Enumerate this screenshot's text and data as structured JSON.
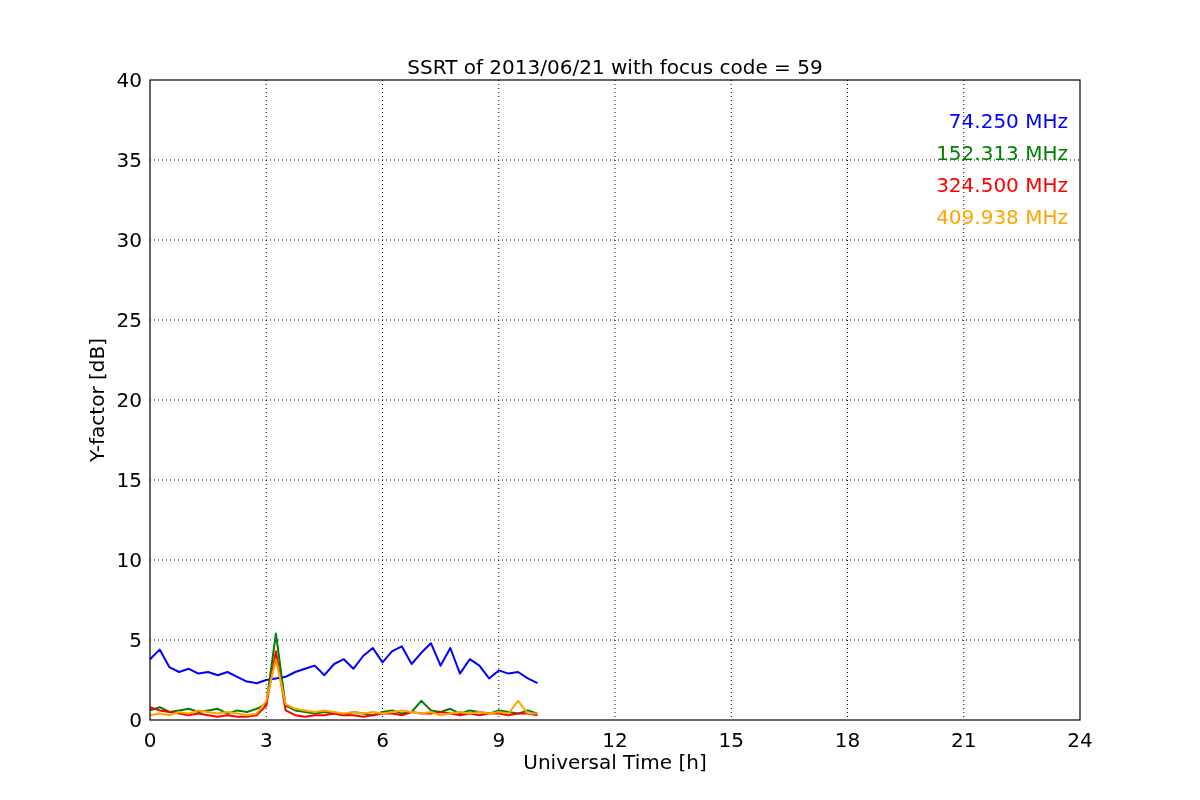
{
  "chart_data": {
    "type": "line",
    "title": "SSRT of 2013/06/21 with focus code = 59",
    "xlabel": "Universal Time [h]",
    "ylabel": "Y-factor [dB]",
    "x": [
      0,
      0.25,
      0.5,
      0.75,
      1,
      1.25,
      1.5,
      1.75,
      2,
      2.25,
      2.5,
      2.75,
      3,
      3.25,
      3.5,
      3.75,
      4,
      4.25,
      4.5,
      4.75,
      5,
      5.25,
      5.5,
      5.75,
      6,
      6.25,
      6.5,
      6.75,
      7,
      7.25,
      7.5,
      7.75,
      8,
      8.25,
      8.5,
      8.75,
      9,
      9.25,
      9.5,
      9.75,
      10
    ],
    "series": [
      {
        "name": "74.250 MHz",
        "color": "#0000ff",
        "values": [
          3.8,
          4.4,
          3.3,
          3.0,
          3.2,
          2.9,
          3.0,
          2.8,
          3.0,
          2.7,
          2.4,
          2.3,
          2.5,
          2.6,
          2.7,
          3.0,
          3.2,
          3.4,
          2.8,
          3.5,
          3.8,
          3.2,
          4.0,
          4.5,
          3.6,
          4.3,
          4.6,
          3.5,
          4.2,
          4.8,
          3.4,
          4.5,
          2.9,
          3.8,
          3.4,
          2.6,
          3.1,
          2.9,
          3.0,
          2.6,
          2.3
        ]
      },
      {
        "name": "152.313 MHz",
        "color": "#008000",
        "values": [
          0.6,
          0.8,
          0.5,
          0.6,
          0.7,
          0.5,
          0.6,
          0.7,
          0.4,
          0.6,
          0.5,
          0.7,
          1.0,
          5.4,
          0.9,
          0.6,
          0.5,
          0.4,
          0.5,
          0.4,
          0.3,
          0.5,
          0.4,
          0.3,
          0.5,
          0.6,
          0.4,
          0.5,
          1.2,
          0.6,
          0.5,
          0.7,
          0.4,
          0.6,
          0.5,
          0.4,
          0.6,
          0.5,
          0.4,
          0.6,
          0.4
        ]
      },
      {
        "name": "324.500 MHz",
        "color": "#ff0000",
        "values": [
          0.8,
          0.6,
          0.5,
          0.4,
          0.3,
          0.4,
          0.3,
          0.2,
          0.3,
          0.2,
          0.2,
          0.3,
          0.9,
          4.3,
          0.6,
          0.3,
          0.2,
          0.3,
          0.3,
          0.4,
          0.3,
          0.3,
          0.2,
          0.3,
          0.4,
          0.4,
          0.3,
          0.5,
          0.4,
          0.4,
          0.5,
          0.4,
          0.3,
          0.4,
          0.3,
          0.4,
          0.4,
          0.3,
          0.4,
          0.4,
          0.3
        ]
      },
      {
        "name": "409.938 MHz",
        "color": "#ffa500",
        "values": [
          0.3,
          0.4,
          0.3,
          0.5,
          0.4,
          0.6,
          0.5,
          0.4,
          0.5,
          0.4,
          0.3,
          0.4,
          1.2,
          3.8,
          1.0,
          0.7,
          0.6,
          0.5,
          0.6,
          0.5,
          0.4,
          0.5,
          0.4,
          0.5,
          0.4,
          0.5,
          0.6,
          0.5,
          0.4,
          0.5,
          0.3,
          0.4,
          0.5,
          0.4,
          0.5,
          0.4,
          0.5,
          0.4,
          1.2,
          0.4,
          0.4
        ]
      }
    ],
    "xlim": [
      0,
      24
    ],
    "ylim": [
      0,
      40
    ],
    "xticks": [
      0,
      3,
      6,
      9,
      12,
      15,
      18,
      21,
      24
    ],
    "yticks": [
      0,
      5,
      10,
      15,
      20,
      25,
      30,
      35,
      40
    ],
    "grid": true
  }
}
